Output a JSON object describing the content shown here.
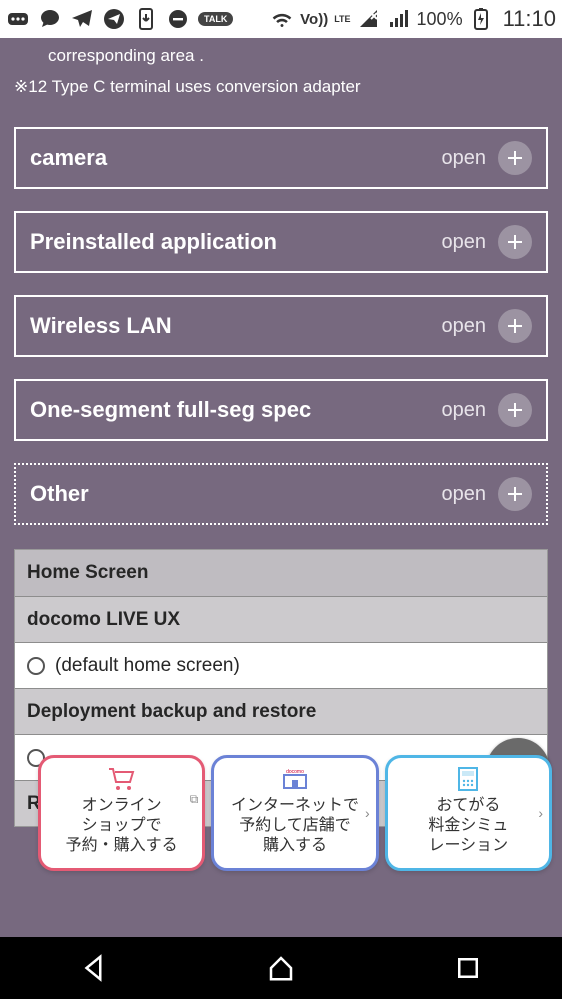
{
  "status": {
    "battery_pct": "100%",
    "clock": "11:10",
    "volte": "Vo))",
    "lte": "LTE",
    "talk": "TALK"
  },
  "page": {
    "partial_line": "corresponding area .",
    "note12": "※12 Type C terminal uses conversion adapter"
  },
  "accordion": {
    "open_label": "open",
    "items": [
      {
        "title": "camera"
      },
      {
        "title": "Preinstalled application"
      },
      {
        "title": "Wireless LAN"
      },
      {
        "title": "One-segment full-seg spec"
      },
      {
        "title": "Other"
      }
    ]
  },
  "detail": {
    "rows": [
      {
        "kind": "head",
        "text": "Home Screen"
      },
      {
        "kind": "sub",
        "text": "docomo LIVE UX"
      },
      {
        "kind": "cell",
        "radio": true,
        "text": "(default home screen)"
      },
      {
        "kind": "sub",
        "text": "Deployment backup and restore"
      },
      {
        "kind": "cell",
        "radio": true,
        "text": ""
      },
      {
        "kind": "sub",
        "text": "R"
      }
    ]
  },
  "cta": {
    "cards": [
      {
        "brand": "",
        "text": "オンライン\nショップで\n予約・購入する"
      },
      {
        "brand": "docomo",
        "text": "インターネットで\n予約して店舗で\n購入する"
      },
      {
        "brand": "",
        "text": "おてがる\n料金シミュ\nレーション"
      }
    ]
  }
}
